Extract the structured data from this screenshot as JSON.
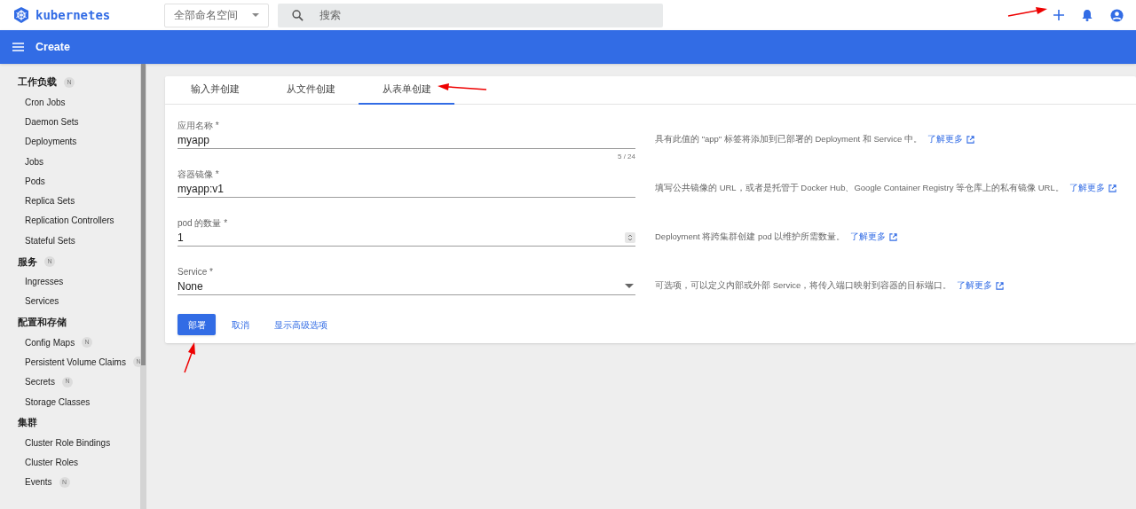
{
  "header": {
    "logo": "kubernetes",
    "namespace": "全部命名空间",
    "search_placeholder": "搜索"
  },
  "toolbar": {
    "title": "Create"
  },
  "sidebar": [
    {
      "title": "工作负载",
      "badge": "N",
      "items": [
        {
          "label": "Cron Jobs"
        },
        {
          "label": "Daemon Sets"
        },
        {
          "label": "Deployments"
        },
        {
          "label": "Jobs"
        },
        {
          "label": "Pods"
        },
        {
          "label": "Replica Sets"
        },
        {
          "label": "Replication Controllers"
        },
        {
          "label": "Stateful Sets"
        }
      ]
    },
    {
      "title": "服务",
      "badge": "N",
      "items": [
        {
          "label": "Ingresses"
        },
        {
          "label": "Services"
        }
      ]
    },
    {
      "title": "配置和存储",
      "items": [
        {
          "label": "Config Maps",
          "badge": "N"
        },
        {
          "label": "Persistent Volume Claims",
          "badge": "N"
        },
        {
          "label": "Secrets",
          "badge": "N"
        },
        {
          "label": "Storage Classes"
        }
      ]
    },
    {
      "title": "集群",
      "items": [
        {
          "label": "Cluster Role Bindings"
        },
        {
          "label": "Cluster Roles"
        },
        {
          "label": "Events",
          "badge": "N"
        }
      ]
    }
  ],
  "tabs": [
    {
      "label": "输入并创建",
      "selected": false
    },
    {
      "label": "从文件创建",
      "selected": false
    },
    {
      "label": "从表单创建",
      "selected": true
    }
  ],
  "fields": [
    {
      "kind": "text",
      "label": "应用名称 *",
      "value": "myapp",
      "counter": "5 / 24",
      "help": "具有此值的 \"app\" 标签将添加到已部署的 Deployment 和 Service 中。",
      "link": "了解更多"
    },
    {
      "kind": "text",
      "label": "容器镜像 *",
      "value": "myapp:v1",
      "help": "填写公共镜像的 URL，或者是托管于 Docker Hub、Google Container Registry 等仓库上的私有镜像 URL。",
      "link": "了解更多"
    },
    {
      "kind": "number",
      "label": "pod 的数量 *",
      "value": "1",
      "help": "Deployment 将跨集群创建 pod 以维护所需数量。",
      "link": "了解更多"
    },
    {
      "kind": "select",
      "label": "Service *",
      "value": "None",
      "help": "可选项，可以定义内部或外部 Service，将传入端口映射到容器的目标端口。",
      "link": "了解更多"
    }
  ],
  "actions": {
    "deploy": "部署",
    "cancel": "取消",
    "advanced": "显示高级选项"
  }
}
